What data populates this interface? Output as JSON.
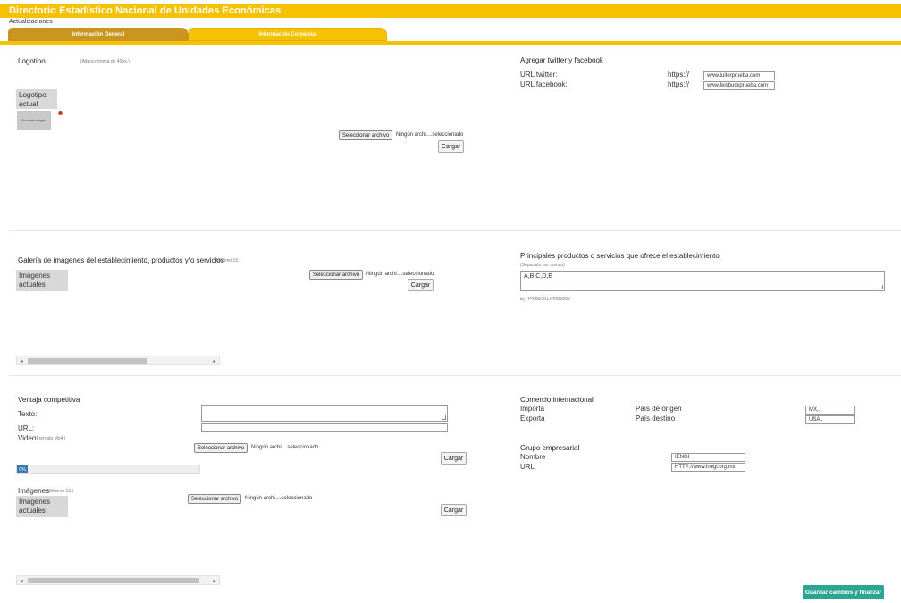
{
  "header": {
    "title": "Directorio Estadístico Nacional de Unidades Económicas",
    "subtitle": "Actualizaciones",
    "tabs": [
      {
        "label": "Información General"
      },
      {
        "label": "Información Comercial"
      }
    ],
    "colors": {
      "primary": "#f6c200",
      "tab_inactive": "#c9951e",
      "accent_button": "#2aa692"
    }
  },
  "logo": {
    "title": "Logotipo",
    "hint": "(Altura mínima de 40px.)",
    "current_label": "Logotipo actual",
    "thumb_text": "No existe imagen",
    "file_button": "Seleccionar archivo",
    "file_status": "Ningún archi....seleccionado",
    "upload_button": "Cargar"
  },
  "social": {
    "title": "Agregar twitter y facebook",
    "twitter_label": "URL twitter:",
    "facebook_label": "URL facebook:",
    "prefix": "https://",
    "twitter_value": "www.tuiterprueba.com",
    "facebook_value": "www.feisbuckprueba.com"
  },
  "gallery": {
    "title": "Galería de imágenes del establecimiento, productos y/o servicios",
    "hint": "(Máximo 15.)",
    "current_label": "Imágenes actuales",
    "file_button": "Seleccionar archivo",
    "file_status": "Ningún archi....seleccionado",
    "upload_button": "Cargar"
  },
  "products": {
    "title": "Principales productos o servicios que ofrece el establecimiento",
    "hint": "(Separado por comas)",
    "value": "A,B,C,D,E",
    "example": "Ej. \"Producto1,Producto2\""
  },
  "competitive": {
    "title": "Ventaja competitiva",
    "text_label": "Texto:",
    "url_label": "URL:",
    "video_label": "Video",
    "video_hint": "(Formato Mp4 )",
    "file_button": "Seleccionar archivo",
    "file_status": "Ningún archi....seleccionado",
    "upload_button": "Cargar",
    "progress_text": "0%",
    "progress_value": 0,
    "images_label": "Imágenes",
    "images_hint": "(Máximo 10.)",
    "current_label": "Imágenes actuales",
    "images_file_button": "Seleccionar archivo",
    "images_file_status": "Ningún archi....seleccionado",
    "images_upload_button": "Cargar"
  },
  "trade": {
    "title": "Comercio internacional",
    "import_label": "Importa",
    "export_label": "Exporta",
    "origin_label": "País de origen",
    "destination_label": "País destino",
    "origin_value": "MX,,",
    "destination_value": "USA,,"
  },
  "group": {
    "title": "Grupo empresarial",
    "name_label": "Nombre",
    "url_label": "URL",
    "name_value": "IENGI",
    "url_value": "HTTP://www.inegi.org.mx"
  },
  "footer": {
    "save_button": "Guardar cambios y finalizar"
  }
}
